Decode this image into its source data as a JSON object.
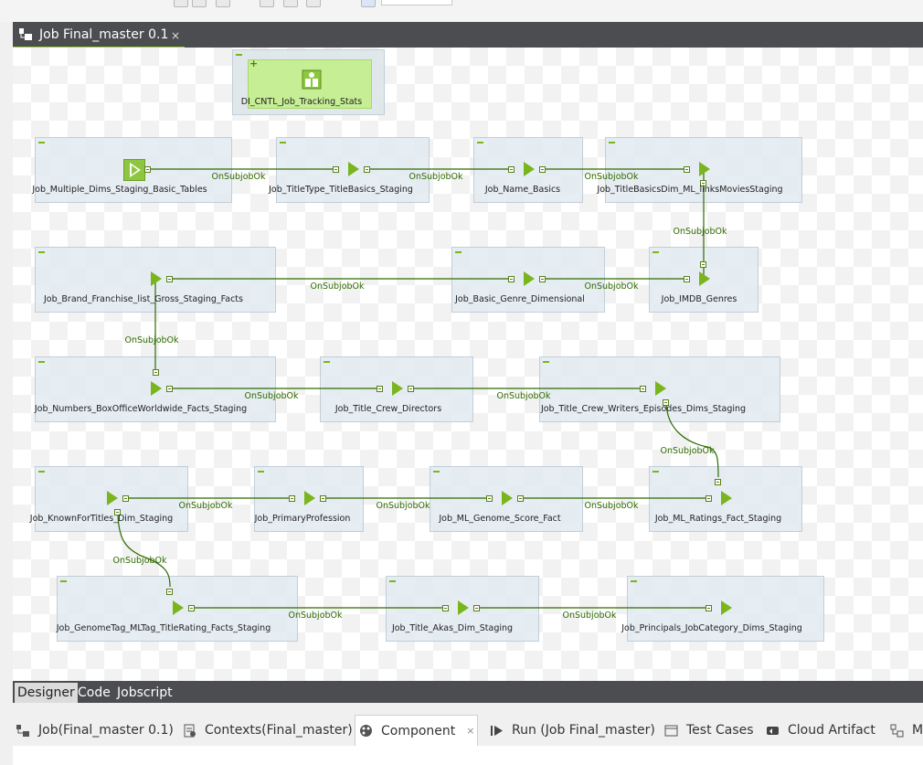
{
  "editor": {
    "tab_title": "Job Final_master 0.1",
    "close_glyph": "×"
  },
  "stats_component": {
    "label": "DI_CNTL_Job_Tracking_Stats",
    "icon": "tracking-stats-icon"
  },
  "components": [
    {
      "name": "Job_Multiple_Dims_Staging_Basic_Tables"
    },
    {
      "name": "Job_TitleType_TitleBasics_Staging"
    },
    {
      "name": "Job_Name_Basics"
    },
    {
      "name": "Job_TitleBasicsDim_ML_linksMoviesStaging"
    },
    {
      "name": "Job_Brand_Franchise_list_Gross_Staging_Facts"
    },
    {
      "name": "Job_Basic_Genre_Dimensional"
    },
    {
      "name": "Job_IMDB_Genres"
    },
    {
      "name": "Job_Numbers_BoxOfficeWorldwide_Facts_Staging"
    },
    {
      "name": "Job_Title_Crew_Directors"
    },
    {
      "name": "Job_Title_Crew_Writers_Episodes_Dims_Staging"
    },
    {
      "name": "Job_KnownForTitles_Dim_Staging"
    },
    {
      "name": "Job_PrimaryProfession"
    },
    {
      "name": "Job_ML_Genome_Score_Fact"
    },
    {
      "name": "Job_ML_Ratings_Fact_Staging"
    },
    {
      "name": "Job_GenomeTag_MLTag_TitleRating_Facts_Staging"
    },
    {
      "name": "Job_Title_Akas_Dim_Staging"
    },
    {
      "name": "Job_Principals_JobCategory_Dims_Staging"
    }
  ],
  "link_label": "OnSubjobOk",
  "bottom_tabs": [
    "Designer",
    "Code",
    "Jobscript"
  ],
  "active_bottom_tab": "Designer",
  "view_tabs": [
    {
      "label": "Job(Final_master 0.1)",
      "icon": "job-icon"
    },
    {
      "label": "Contexts(Final_master)",
      "icon": "contexts-icon"
    },
    {
      "label": "Component",
      "icon": "component-icon",
      "active": true
    },
    {
      "label": "Run (Job Final_master)",
      "icon": "run-icon"
    },
    {
      "label": "Test Cases",
      "icon": "test-cases-icon"
    },
    {
      "label": "Cloud Artifact",
      "icon": "cloud-artifact-icon"
    },
    {
      "label": "M",
      "icon": "modules-icon"
    }
  ],
  "colors": {
    "accent": "#9bd31c",
    "link": "#2f6b00",
    "dark_bar": "#4b4d51"
  }
}
